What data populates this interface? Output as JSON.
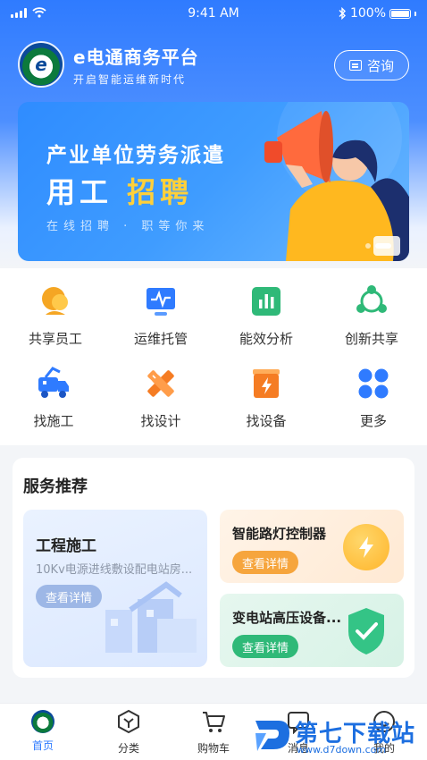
{
  "status_bar": {
    "time": "9:41 AM",
    "battery": "100%"
  },
  "brand": {
    "logo_text": "e",
    "title": "e电通商务平台",
    "subtitle": "开启智能运维新时代"
  },
  "header": {
    "consult_label": "咨询"
  },
  "banner": {
    "line1": "产业单位劳务派遣",
    "line2_white": "用工",
    "line2_yellow": "招聘",
    "line3": "在线招聘 · 职等你来"
  },
  "grid": [
    {
      "label": "共享员工",
      "icon": "shared-staff-icon",
      "color": "#f5a623"
    },
    {
      "label": "运维托管",
      "icon": "monitor-icon",
      "color": "#2f7bff"
    },
    {
      "label": "能效分析",
      "icon": "bar-chart-icon",
      "color": "#2fb978"
    },
    {
      "label": "创新共享",
      "icon": "share-nodes-icon",
      "color": "#2fb978"
    },
    {
      "label": "找施工",
      "icon": "construction-truck-icon",
      "color": "#2f7bff"
    },
    {
      "label": "找设计",
      "icon": "design-tools-icon",
      "color": "#f57c23"
    },
    {
      "label": "找设备",
      "icon": "equipment-box-icon",
      "color": "#f57c23"
    },
    {
      "label": "更多",
      "icon": "more-grid-icon",
      "color": "#2f7bff"
    }
  ],
  "services": {
    "title": "服务推荐",
    "big": {
      "title": "工程施工",
      "desc": "10Kv电源进线敷设配电站房...",
      "button": "查看详情"
    },
    "a": {
      "title": "智能路灯控制器",
      "button": "查看详情"
    },
    "b": {
      "title": "变电站高压设备...",
      "button": "查看详情"
    }
  },
  "tabbar": [
    {
      "label": "首页",
      "icon": "home-logo-icon",
      "active": true
    },
    {
      "label": "分类",
      "icon": "category-icon",
      "active": false
    },
    {
      "label": "购物车",
      "icon": "cart-icon",
      "active": false
    },
    {
      "label": "消息",
      "icon": "message-icon",
      "active": false
    },
    {
      "label": "我的",
      "icon": "profile-icon",
      "active": false
    }
  ],
  "watermark": {
    "name": "第七下载站",
    "url": "www.d7down.com"
  },
  "colors": {
    "primary": "#2f7bff",
    "accent_yellow": "#ffd03a",
    "orange": "#f6a53d",
    "green": "#2fb978"
  }
}
